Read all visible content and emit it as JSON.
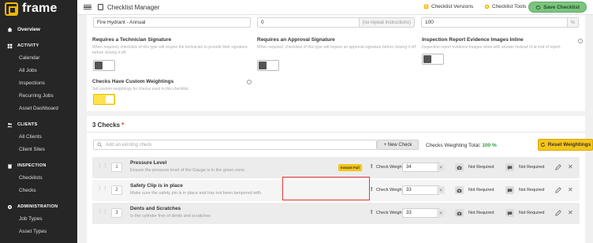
{
  "app": {
    "logo_text": "frame"
  },
  "sidebar": {
    "overview": "Overview",
    "sections": [
      {
        "heading": "ACTIVITY",
        "items": [
          "Calendar",
          "All Jobs",
          "Inspections",
          "Recurring Jobs",
          "Asset Dashboard"
        ]
      },
      {
        "heading": "CLIENTS",
        "items": [
          "All Clients",
          "Client Sites"
        ]
      },
      {
        "heading": "INSPECTION",
        "items": [
          "Checklists",
          "Checks"
        ]
      },
      {
        "heading": "ADMINISTRATION",
        "items": [
          "Job Types",
          "Asset Types"
        ]
      }
    ]
  },
  "topbar": {
    "title": "Checklist Manager",
    "versions_label": "Checklist Versions",
    "tools_label": "Checklist Tools",
    "save_label": "Save Checklist"
  },
  "form": {
    "name_value": "Fire Hydrant - Annual",
    "repeat_value": "0",
    "repeat_suffix": "(no repeat instructions)",
    "percent_value": "100",
    "percent_suffix": "%"
  },
  "options": {
    "tech_sig": {
      "title": "Requires a Technician Signature",
      "desc": "When required, checklists of this type will require the technician to provide their signature before closing it off.",
      "on": false
    },
    "approval_sig": {
      "title": "Requires an Approval Signature",
      "desc": "When required, checklists of this type will require an approval signature before closing it off.",
      "on": false
    },
    "evidence": {
      "title": "Inspection Report Evidence Images Inline",
      "desc": "Inspection report evidence images inline with answer instead of at end of report.",
      "on": false
    },
    "weightings": {
      "title": "Checks Have Custom Weightings",
      "desc": "Set custom weightings for checks used in this checklist.",
      "on": true
    }
  },
  "checks": {
    "heading": "3 Checks",
    "required_mark": "*",
    "search_placeholder": "Add an existing check",
    "new_check_label": "+ New Check",
    "weight_total_label": "Checks Weighting Total:",
    "weight_total_value": "100 %",
    "reset_label": "Reset Weightings",
    "weight_label": "Check Weight",
    "not_required": "Not Required",
    "rows": [
      {
        "num": "1",
        "title": "Pressure Level",
        "desc": "Ensure the pressure level of the Gauge is in the green zone",
        "badge": "Instant Fail",
        "weight": "34"
      },
      {
        "num": "2",
        "title": "Safety Clip is in place",
        "desc": "Make sure the safety pin is in place and has not been tampered with",
        "badge": "",
        "weight": "33"
      },
      {
        "num": "3",
        "title": "Dents and Scratches",
        "desc": "Is the cylinder free of dents and scratches",
        "badge": "",
        "weight": "33"
      }
    ]
  }
}
